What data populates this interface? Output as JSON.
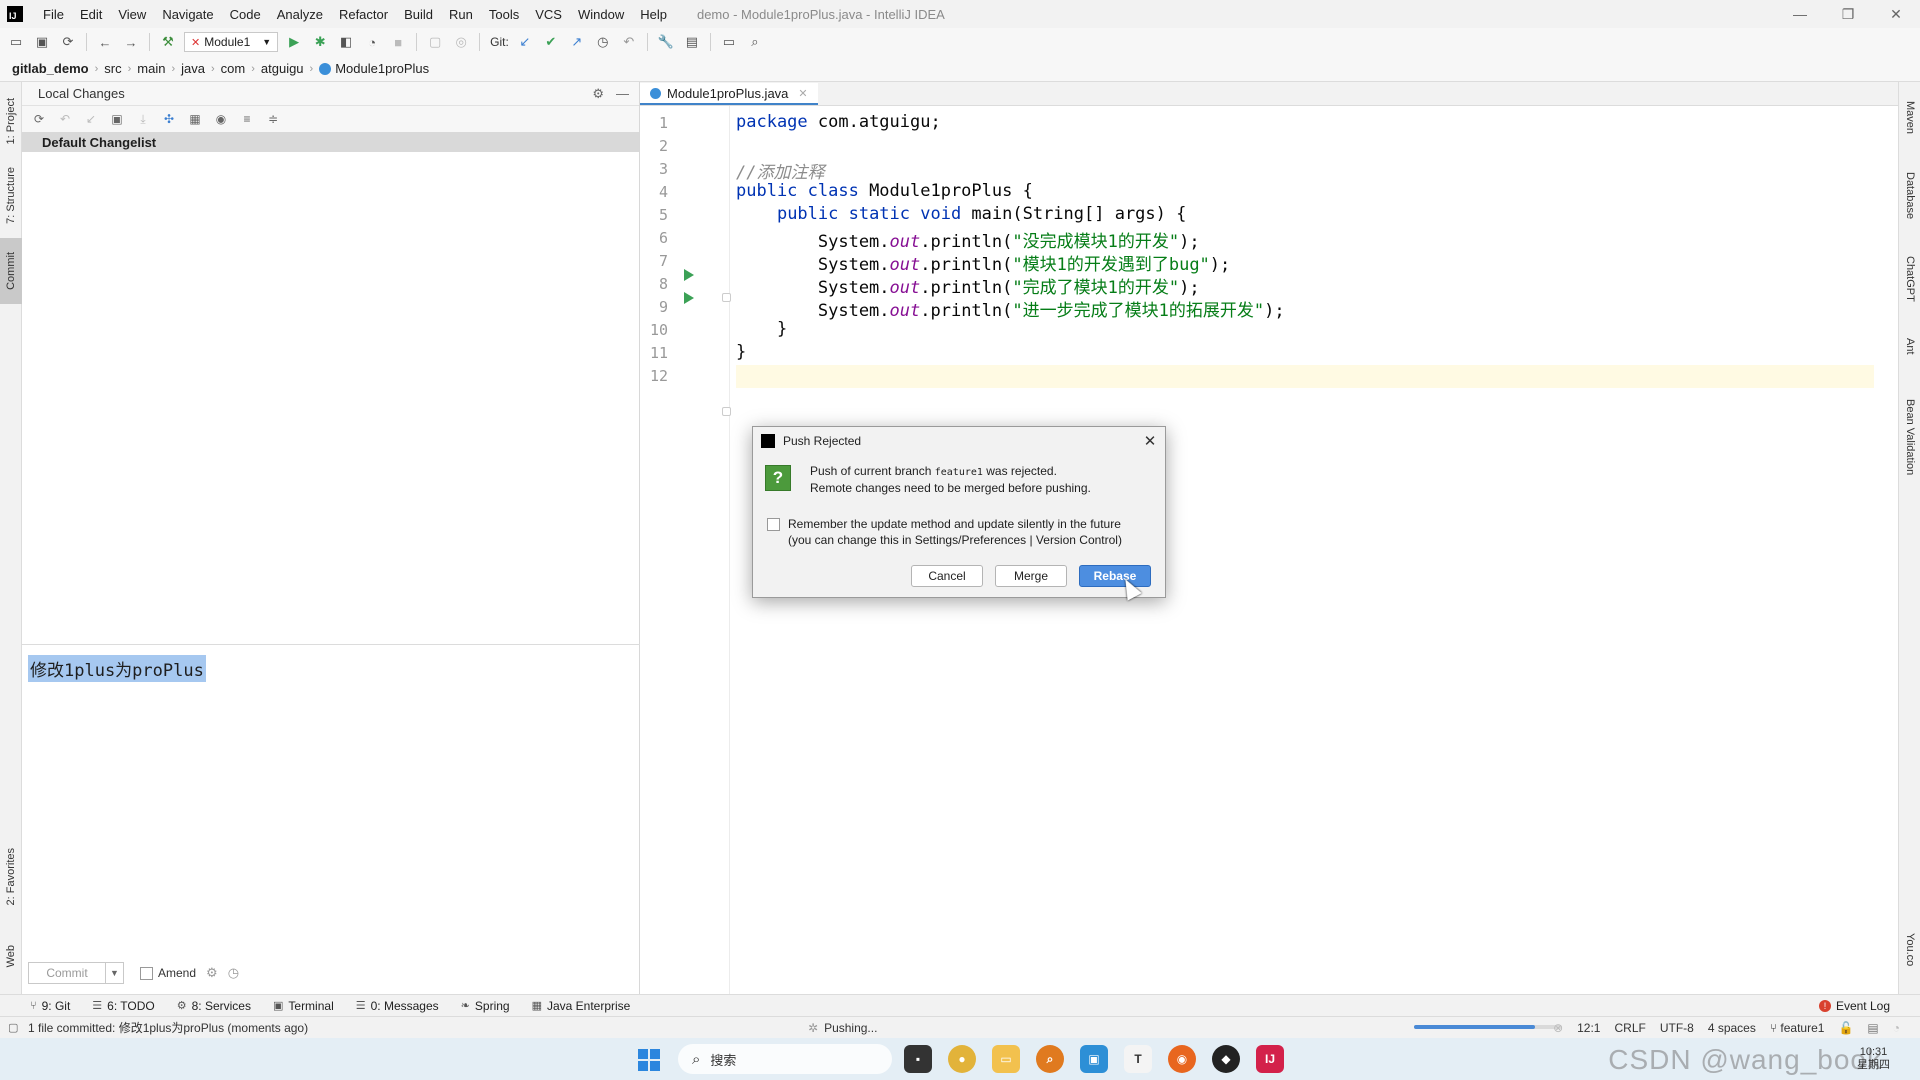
{
  "titlebar": {
    "logo": "IJ",
    "menu": [
      "File",
      "Edit",
      "View",
      "Navigate",
      "Code",
      "Analyze",
      "Refactor",
      "Build",
      "Run",
      "Tools",
      "VCS",
      "Window",
      "Help"
    ],
    "window_title": "demo - Module1proPlus.java - IntelliJ IDEA",
    "controls": [
      "—",
      "❐",
      "✕"
    ]
  },
  "toolbar": {
    "module": "Module1",
    "git_label": "Git:"
  },
  "breadcrumb": [
    "gitlab_demo",
    "src",
    "main",
    "java",
    "com",
    "atguigu",
    "Module1proPlus"
  ],
  "left_tool_tabs": [
    "1: Project",
    "7: Structure",
    "Commit",
    "2: Favorites",
    "Web"
  ],
  "right_tool_tabs": [
    "Maven",
    "Database",
    "ChatGPT",
    "Ant",
    "Bean Validation",
    "You.co"
  ],
  "commit_panel": {
    "title": "Local Changes",
    "changelist": "Default Changelist",
    "message": "修改1plus为proPlus",
    "commit_button": "Commit",
    "amend_label": "Amend"
  },
  "editor": {
    "tab_label": "Module1proPlus.java",
    "lines": [
      {
        "n": "1",
        "parts": [
          {
            "c": "kw",
            "t": "package "
          },
          {
            "c": "",
            "t": "com.atguigu;"
          }
        ]
      },
      {
        "n": "2",
        "parts": []
      },
      {
        "n": "3",
        "parts": [
          {
            "c": "cm",
            "t": "//添加注释"
          }
        ]
      },
      {
        "n": "4",
        "parts": [
          {
            "c": "kw",
            "t": "public class "
          },
          {
            "c": "",
            "t": "Module1proPlus {"
          }
        ]
      },
      {
        "n": "5",
        "parts": [
          {
            "c": "",
            "t": "    "
          },
          {
            "c": "kw",
            "t": "public static void "
          },
          {
            "c": "",
            "t": "main(String[] args) {"
          }
        ]
      },
      {
        "n": "6",
        "parts": [
          {
            "c": "",
            "t": "        System."
          },
          {
            "c": "fd",
            "t": "out"
          },
          {
            "c": "",
            "t": ".println("
          },
          {
            "c": "st",
            "t": "\"没完成模块1的开发\""
          },
          {
            "c": "",
            "t": ");"
          }
        ]
      },
      {
        "n": "7",
        "parts": [
          {
            "c": "",
            "t": "        System."
          },
          {
            "c": "fd",
            "t": "out"
          },
          {
            "c": "",
            "t": ".println("
          },
          {
            "c": "st",
            "t": "\"模块1的开发遇到了bug\""
          },
          {
            "c": "",
            "t": ");"
          }
        ]
      },
      {
        "n": "8",
        "parts": [
          {
            "c": "",
            "t": "        System."
          },
          {
            "c": "fd",
            "t": "out"
          },
          {
            "c": "",
            "t": ".println("
          },
          {
            "c": "st",
            "t": "\"完成了模块1的开发\""
          },
          {
            "c": "",
            "t": ");"
          }
        ]
      },
      {
        "n": "9",
        "parts": [
          {
            "c": "",
            "t": "        System."
          },
          {
            "c": "fd",
            "t": "out"
          },
          {
            "c": "",
            "t": ".println("
          },
          {
            "c": "st",
            "t": "\"进一步完成了模块1的拓展开发\""
          },
          {
            "c": "",
            "t": ");"
          }
        ]
      },
      {
        "n": "10",
        "parts": [
          {
            "c": "",
            "t": "    }"
          }
        ]
      },
      {
        "n": "11",
        "parts": [
          {
            "c": "",
            "t": "}"
          }
        ]
      },
      {
        "n": "12",
        "parts": []
      }
    ]
  },
  "dialog": {
    "title": "Push Rejected",
    "message_prefix": "Push of current branch ",
    "branch": "feature1",
    "message_suffix": " was rejected.",
    "message_line2": "Remote changes need to be merged before pushing.",
    "remember_line1": "Remember the update method and update silently in the future",
    "remember_line2": "(you can change this in Settings/Preferences | Version Control)",
    "buttons": {
      "cancel": "Cancel",
      "merge": "Merge",
      "rebase": "Rebase"
    }
  },
  "tool_window_bar": {
    "items": [
      {
        "icon": "⑂",
        "label": "9: Git"
      },
      {
        "icon": "☰",
        "label": "6: TODO"
      },
      {
        "icon": "⚙",
        "label": "8: Services"
      },
      {
        "icon": "▣",
        "label": "Terminal"
      },
      {
        "icon": "☰",
        "label": "0: Messages"
      },
      {
        "icon": "❧",
        "label": "Spring"
      },
      {
        "icon": "▦",
        "label": "Java Enterprise"
      }
    ],
    "event_log": "Event Log"
  },
  "status_bar": {
    "left": "1 file committed: 修改1plus为proPlus (moments ago)",
    "pushing": "Pushing...",
    "progress": 0.82,
    "position": "12:1",
    "line_sep": "CRLF",
    "encoding": "UTF-8",
    "indent": "4 spaces",
    "branch": "feature1"
  },
  "taskbar": {
    "search": "搜索",
    "watermark": "CSDN @wang_book",
    "clock_time": "10:31",
    "clock_day": "星期四"
  },
  "colors": {
    "accent": "#4d8ee0",
    "keyword": "#0033b3",
    "string": "#067d17",
    "comment": "#8c8c8c"
  }
}
